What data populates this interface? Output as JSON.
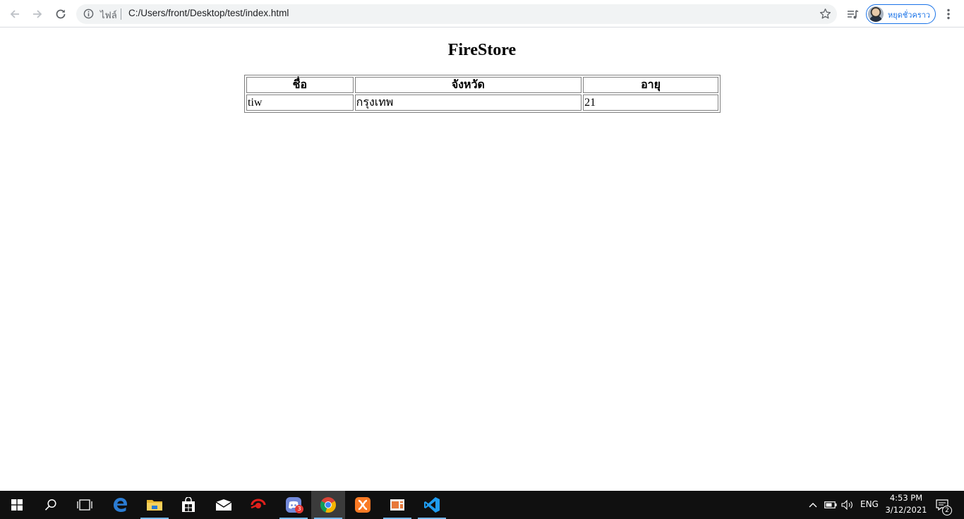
{
  "browser": {
    "address_prefix": "ไฟล์",
    "url": "C:/Users/front/Desktop/test/index.html",
    "profile_name": "หยุดชั่วคราว"
  },
  "page": {
    "heading": "FireStore",
    "table": {
      "headers": [
        "ชื่อ",
        "จังหวัด",
        "อายุ"
      ],
      "rows": [
        [
          "tiw",
          "กรุงเทพ",
          "21"
        ]
      ]
    }
  },
  "taskbar": {
    "apps": [
      "start",
      "search",
      "task-view",
      "edge",
      "file-explorer",
      "store",
      "mail",
      "garena",
      "discord",
      "chrome",
      "xampp",
      "photo-app",
      "vscode"
    ],
    "discord_badge": "3",
    "language": "ENG",
    "time": "4:53 PM",
    "date": "3/12/2021",
    "notification_count": "2"
  }
}
